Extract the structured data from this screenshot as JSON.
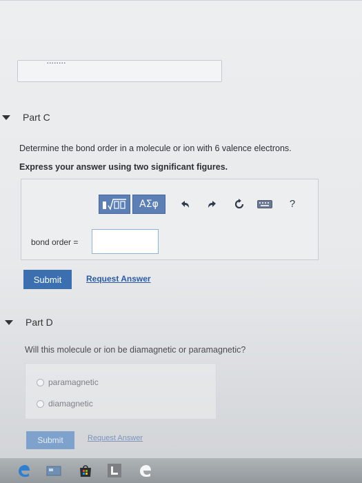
{
  "previous_part": {
    "cut_off_label": "........"
  },
  "part_c": {
    "title": "Part C",
    "question": "Determine the bond order in a molecule or ion with 6 valence electrons.",
    "instruction": "Express your answer using two significant figures.",
    "toolbar": {
      "greek_label": "ΑΣφ",
      "help_label": "?"
    },
    "answer_label": "bond order =",
    "answer_value": "",
    "submit_label": "Submit",
    "request_answer_label": "Request Answer"
  },
  "part_d": {
    "title": "Part D",
    "question": "Will this molecule or ion be diamagnetic or paramagnetic?",
    "options": [
      "paramagnetic",
      "diamagnetic"
    ],
    "submit_label": "Submit",
    "request_answer_label": "Request Answer"
  },
  "colors": {
    "primary_button": "#3b6fb0",
    "toolbar_button": "#5c80b5",
    "link": "#2a5aa5"
  },
  "icons": [
    "template-icon",
    "greek-symbols",
    "undo-icon",
    "redo-icon",
    "reset-icon",
    "keyboard-icon",
    "help-icon",
    "edge-icon",
    "taskview-icon",
    "store-icon",
    "file-explorer-icon",
    "ie-icon"
  ]
}
